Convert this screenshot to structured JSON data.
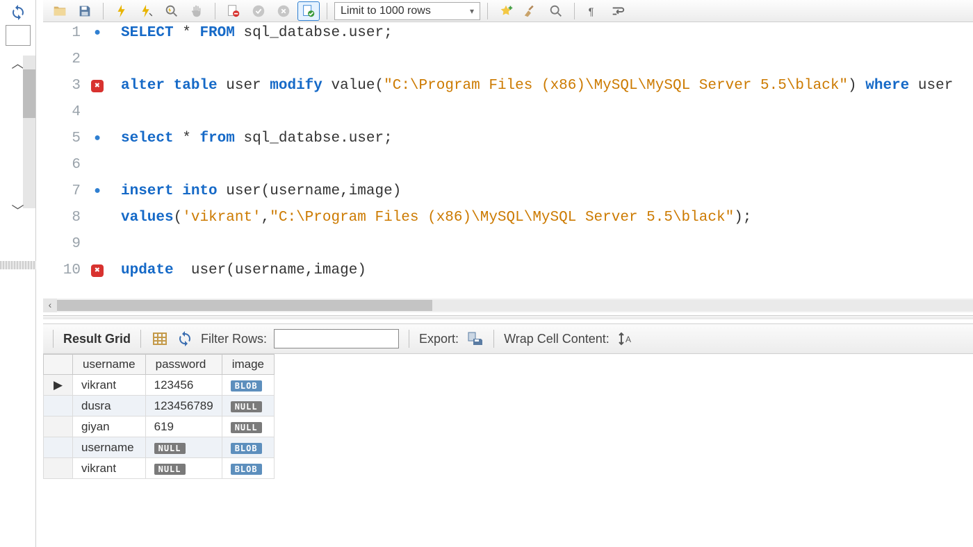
{
  "toolbar": {
    "limit_label": "Limit to 1000 rows"
  },
  "editor": {
    "lines": [
      {
        "n": 1,
        "mark": "dot",
        "tokens": [
          [
            "kw",
            "SELECT"
          ],
          [
            "op",
            " * "
          ],
          [
            "kw",
            "FROM"
          ],
          [
            "op",
            " "
          ],
          [
            "ident",
            "sql_databse"
          ],
          [
            "op",
            "."
          ],
          [
            "ident",
            "user"
          ],
          [
            "op",
            ";"
          ]
        ]
      },
      {
        "n": 2,
        "mark": "",
        "tokens": []
      },
      {
        "n": 3,
        "mark": "err",
        "tokens": [
          [
            "kw",
            "alter table"
          ],
          [
            "op",
            " "
          ],
          [
            "ident",
            "user"
          ],
          [
            "op",
            " "
          ],
          [
            "kw",
            "modify"
          ],
          [
            "op",
            " "
          ],
          [
            "ident",
            "value"
          ],
          [
            "op",
            "("
          ],
          [
            "str",
            "\"C:\\Program Files (x86)\\MySQL\\MySQL Server 5.5\\black\""
          ],
          [
            "op",
            ") "
          ],
          [
            "kw",
            "where"
          ],
          [
            "op",
            " "
          ],
          [
            "ident",
            "user"
          ]
        ]
      },
      {
        "n": 4,
        "mark": "",
        "tokens": []
      },
      {
        "n": 5,
        "mark": "dot",
        "tokens": [
          [
            "kw",
            "select"
          ],
          [
            "op",
            " * "
          ],
          [
            "kw",
            "from"
          ],
          [
            "op",
            " "
          ],
          [
            "ident",
            "sql_databse"
          ],
          [
            "op",
            "."
          ],
          [
            "ident",
            "user"
          ],
          [
            "op",
            ";"
          ]
        ]
      },
      {
        "n": 6,
        "mark": "",
        "tokens": []
      },
      {
        "n": 7,
        "mark": "dot",
        "tokens": [
          [
            "kw",
            "insert into"
          ],
          [
            "op",
            " "
          ],
          [
            "ident",
            "user"
          ],
          [
            "op",
            "("
          ],
          [
            "ident",
            "username"
          ],
          [
            "op",
            ","
          ],
          [
            "ident",
            "image"
          ],
          [
            "op",
            ")"
          ]
        ]
      },
      {
        "n": 8,
        "mark": "",
        "tokens": [
          [
            "kw",
            "values"
          ],
          [
            "op",
            "("
          ],
          [
            "str",
            "'vikrant'"
          ],
          [
            "op",
            ","
          ],
          [
            "str",
            "\"C:\\Program Files (x86)\\MySQL\\MySQL Server 5.5\\black\""
          ],
          [
            "op",
            ");"
          ]
        ]
      },
      {
        "n": 9,
        "mark": "",
        "tokens": []
      },
      {
        "n": 10,
        "mark": "err",
        "tokens": [
          [
            "kw",
            "update"
          ],
          [
            "op",
            "  "
          ],
          [
            "ident",
            "user"
          ],
          [
            "op",
            "("
          ],
          [
            "ident",
            "username"
          ],
          [
            "op",
            ","
          ],
          [
            "ident",
            "image"
          ],
          [
            "op",
            ")"
          ]
        ]
      }
    ]
  },
  "result_bar": {
    "result_grid_label": "Result Grid",
    "filter_label": "Filter Rows:",
    "export_label": "Export:",
    "wrap_label": "Wrap Cell Content:"
  },
  "grid": {
    "columns": [
      "username",
      "password",
      "image"
    ],
    "rows": [
      {
        "selected": true,
        "cells": [
          "vikrant",
          "123456",
          {
            "badge": "BLOB"
          }
        ]
      },
      {
        "selected": false,
        "alt": true,
        "cells": [
          "dusra",
          "123456789",
          {
            "badge": "NULL"
          }
        ]
      },
      {
        "selected": false,
        "cells": [
          "giyan",
          "619",
          {
            "badge": "NULL"
          }
        ]
      },
      {
        "selected": false,
        "alt": true,
        "cells": [
          "username",
          {
            "badge": "NULL"
          },
          {
            "badge": "BLOB"
          }
        ]
      },
      {
        "selected": false,
        "cells": [
          "vikrant",
          {
            "badge": "NULL"
          },
          {
            "badge": "BLOB"
          }
        ]
      }
    ]
  }
}
